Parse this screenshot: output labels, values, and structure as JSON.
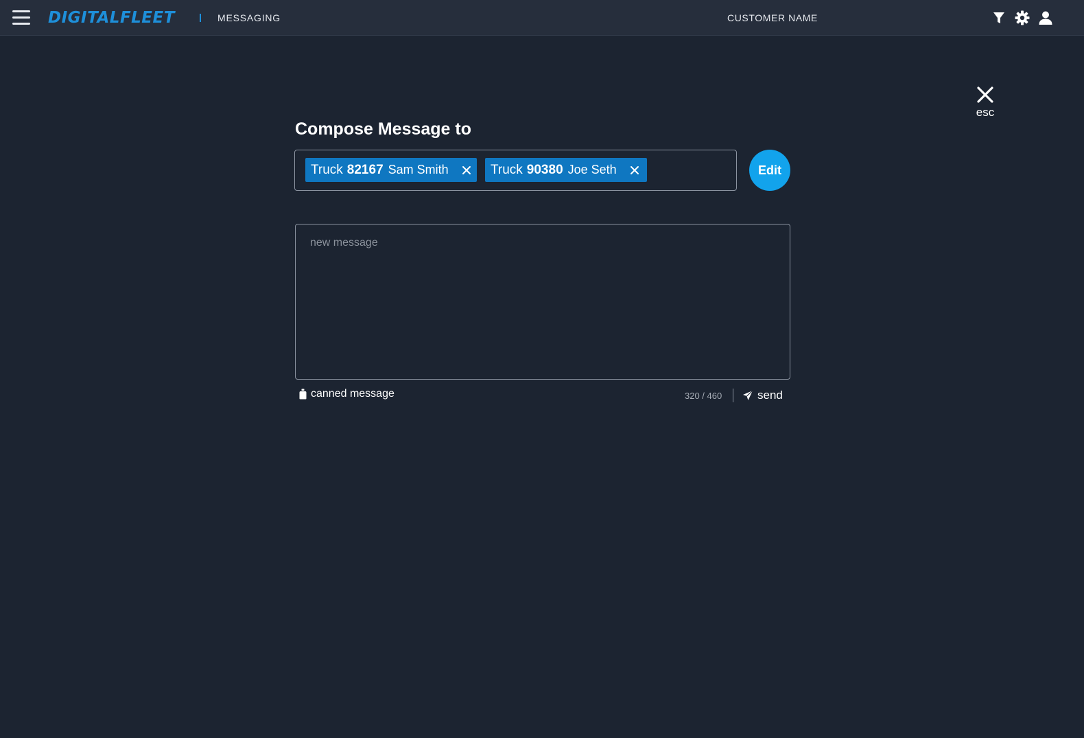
{
  "header": {
    "brand": "DIGITALFLEET",
    "section": "MESSAGING",
    "customer": "CUSTOMER NAME",
    "icons": [
      "menu-icon",
      "filter-icon",
      "gear-icon",
      "user-icon"
    ]
  },
  "dialog": {
    "close_label": "esc",
    "title": "Compose Message to",
    "recipients": [
      {
        "prefix": "Truck",
        "number": "82167",
        "driver": "Sam Smith"
      },
      {
        "prefix": "Truck",
        "number": "90380",
        "driver": "Joe Seth"
      }
    ],
    "edit_label": "Edit",
    "message_placeholder": "new message",
    "canned_label": "canned message",
    "counter": "320 / 460",
    "send_label": "send"
  },
  "colors": {
    "background": "#1c2431",
    "topbar": "#262e3c",
    "brand_blue": "#1e8fd9",
    "chip_blue": "#0f77c1",
    "edit_button": "#12a3ec"
  }
}
